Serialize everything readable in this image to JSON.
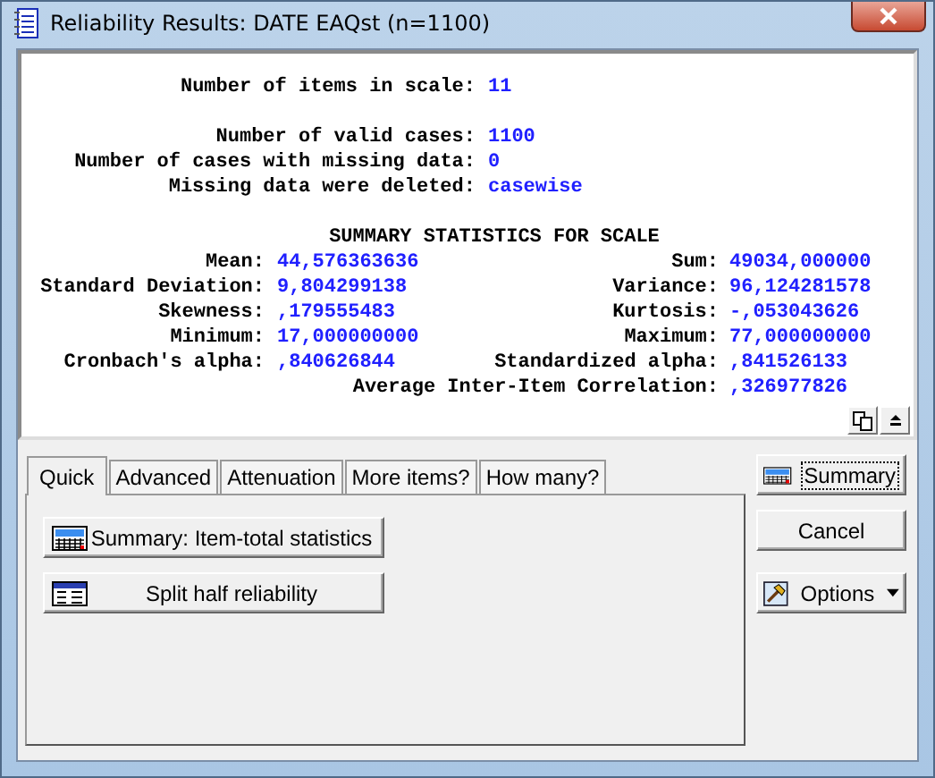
{
  "window": {
    "title": "Reliability Results: DATE EAQst (n=1100)"
  },
  "report": {
    "groups": [
      [
        {
          "label": "Number of items in scale:",
          "value": "11"
        }
      ],
      [
        {
          "label": "Number of valid cases:",
          "value": "1100"
        },
        {
          "label": "Number of cases with missing data:",
          "value": "0"
        },
        {
          "label": "Missing data were deleted:",
          "value": "casewise"
        }
      ]
    ],
    "summary_title": "SUMMARY STATISTICS FOR SCALE",
    "stats": [
      {
        "left_label": "Mean:",
        "left_value": "44,576363636",
        "right_label": "Sum:",
        "right_value": "49034,000000"
      },
      {
        "left_label": "Standard Deviation:",
        "left_value": "9,804299138",
        "right_label": "Variance:",
        "right_value": "96,124281578"
      },
      {
        "left_label": "Skewness:",
        "left_value": ",179555483",
        "right_label": "Kurtosis:",
        "right_value": "-,053043626"
      },
      {
        "left_label": "Minimum:",
        "left_value": "17,000000000",
        "right_label": "Maximum:",
        "right_value": "77,000000000"
      },
      {
        "left_label": "Cronbach's alpha:",
        "left_value": ",840626844",
        "right_label": "Standardized alpha:",
        "right_value": ",841526133"
      },
      {
        "right_label": "Average Inter-Item Correlation:",
        "right_value": ",326977826"
      }
    ]
  },
  "tabs": [
    {
      "label": "Quick",
      "selected": true
    },
    {
      "label": "Advanced",
      "selected": false
    },
    {
      "label": "Attenuation",
      "selected": false
    },
    {
      "label": "More items?",
      "selected": false
    },
    {
      "label": "How many?",
      "selected": false
    }
  ],
  "panel_buttons": [
    {
      "label": "Summary:  Item-total statistics",
      "kind": "summary"
    },
    {
      "label": "Split half reliability",
      "kind": "split"
    }
  ],
  "side_buttons": [
    {
      "label": "Summary",
      "kind": "summary",
      "focused": true
    },
    {
      "label": "Cancel",
      "kind": "plain",
      "focused": false
    },
    {
      "label": "Options",
      "kind": "menu",
      "focused": false
    }
  ]
}
